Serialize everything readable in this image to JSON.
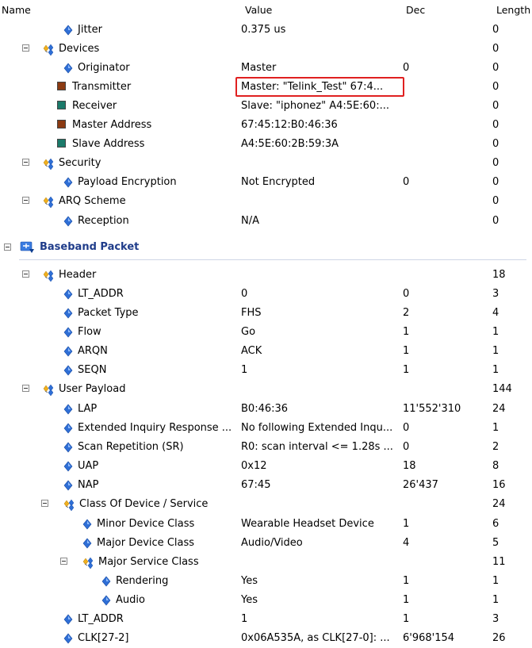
{
  "columns": {
    "name": "Name",
    "value": "Value",
    "dec": "Dec",
    "length": "Length"
  },
  "rows": [
    {
      "name": "Jitter",
      "value": "0.375 us",
      "dec": "",
      "length": "0"
    },
    {
      "name": "Devices",
      "value": "",
      "dec": "",
      "length": "0"
    },
    {
      "name": "Originator",
      "value": "Master",
      "dec": "0",
      "length": "0"
    },
    {
      "name": "Transmitter",
      "value": "Master: \"Telink_Test\" 67:4...",
      "dec": "",
      "length": "0"
    },
    {
      "name": "Receiver",
      "value": "Slave: \"iphonez\" A4:5E:60:...",
      "dec": "",
      "length": "0"
    },
    {
      "name": "Master Address",
      "value": "67:45:12:B0:46:36",
      "dec": "",
      "length": "0"
    },
    {
      "name": "Slave Address",
      "value": "A4:5E:60:2B:59:3A",
      "dec": "",
      "length": "0"
    },
    {
      "name": "Security",
      "value": "",
      "dec": "",
      "length": "0"
    },
    {
      "name": "Payload Encryption",
      "value": "Not Encrypted",
      "dec": "0",
      "length": "0"
    },
    {
      "name": "ARQ Scheme",
      "value": "",
      "dec": "",
      "length": "0"
    },
    {
      "name": "Reception",
      "value": "N/A",
      "dec": "",
      "length": "0"
    },
    {
      "name": "Baseband Packet",
      "value": "",
      "dec": "",
      "length": ""
    },
    {
      "name": "Header",
      "value": "",
      "dec": "",
      "length": "18"
    },
    {
      "name": "LT_ADDR",
      "value": "0",
      "dec": "0",
      "length": "3"
    },
    {
      "name": "Packet Type",
      "value": "FHS",
      "dec": "2",
      "length": "4"
    },
    {
      "name": "Flow",
      "value": "Go",
      "dec": "1",
      "length": "1"
    },
    {
      "name": "ARQN",
      "value": "ACK",
      "dec": "1",
      "length": "1"
    },
    {
      "name": "SEQN",
      "value": "1",
      "dec": "1",
      "length": "1"
    },
    {
      "name": "User Payload",
      "value": "",
      "dec": "",
      "length": "144"
    },
    {
      "name": "LAP",
      "value": "B0:46:36",
      "dec": "11'552'310",
      "length": "24"
    },
    {
      "name": "Extended Inquiry Response ...",
      "value": "No following Extended Inqu...",
      "dec": "0",
      "length": "1"
    },
    {
      "name": "Scan Repetition (SR)",
      "value": "R0: scan interval <= 1.28s ...",
      "dec": "0",
      "length": "2"
    },
    {
      "name": "UAP",
      "value": "0x12",
      "dec": "18",
      "length": "8"
    },
    {
      "name": "NAP",
      "value": "67:45",
      "dec": "26'437",
      "length": "16"
    },
    {
      "name": "Class Of Device / Service",
      "value": "",
      "dec": "",
      "length": "24"
    },
    {
      "name": "Minor Device Class",
      "value": "Wearable Headset Device",
      "dec": "1",
      "length": "6"
    },
    {
      "name": "Major Device Class",
      "value": "Audio/Video",
      "dec": "4",
      "length": "5"
    },
    {
      "name": "Major Service Class",
      "value": "",
      "dec": "",
      "length": "11"
    },
    {
      "name": "Rendering",
      "value": "Yes",
      "dec": "1",
      "length": "1"
    },
    {
      "name": "Audio",
      "value": "Yes",
      "dec": "1",
      "length": "1"
    },
    {
      "name": "LT_ADDR",
      "value": "1",
      "dec": "1",
      "length": "3"
    },
    {
      "name": "CLK[27-2]",
      "value": "0x06A535A, as CLK[27-0]: ...",
      "dec": "6'968'154",
      "length": "26"
    }
  ],
  "colors": {
    "master_square": "#8b3a12",
    "slave_square": "#1b7a6a",
    "highlight_border": "#e02020",
    "section_title": "#1f3c8a",
    "field_icon": "#2f6fd6"
  },
  "icons": {
    "field": "diamond-icon",
    "group": "group-icon",
    "section": "baseband-icon",
    "master": "brown-square-icon",
    "slave": "teal-square-icon"
  }
}
